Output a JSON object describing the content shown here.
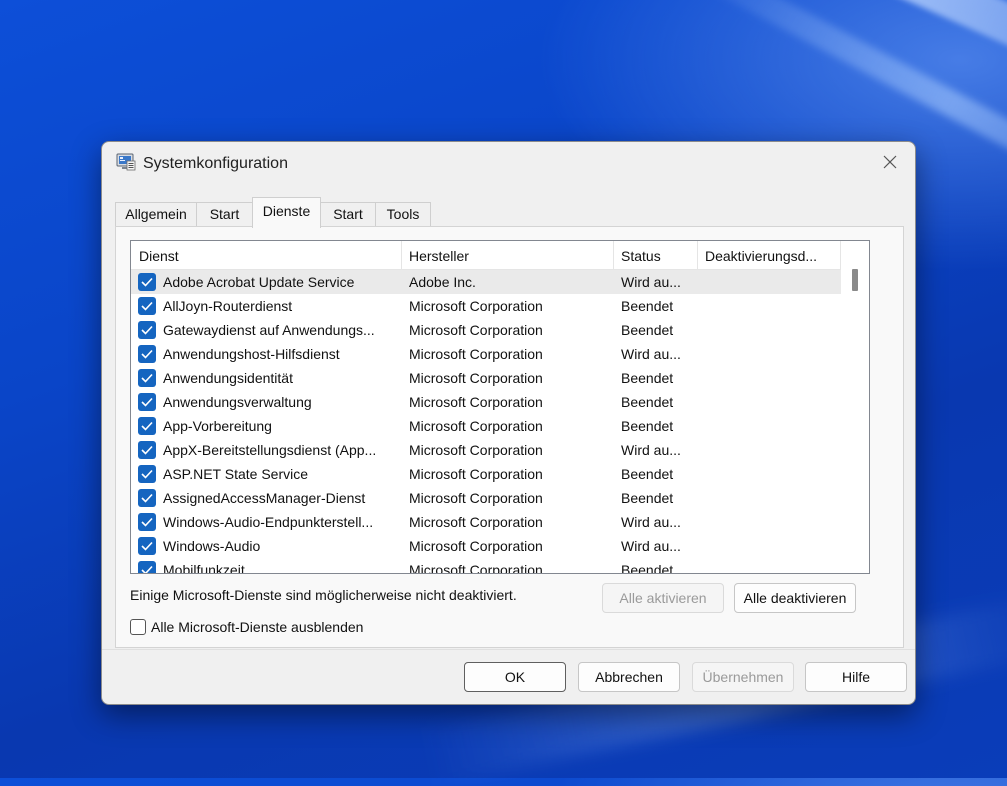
{
  "window": {
    "title": "Systemkonfiguration",
    "close_glyph": "×"
  },
  "tabs": [
    {
      "label": "Allgemein"
    },
    {
      "label": "Start"
    },
    {
      "label": "Dienste",
      "active": true
    },
    {
      "label": "Start"
    },
    {
      "label": "Tools"
    }
  ],
  "table": {
    "columns": [
      "Dienst",
      "Hersteller",
      "Status",
      "Deaktivierungsd..."
    ],
    "rows": [
      {
        "name": "Adobe Acrobat Update Service",
        "vendor": "Adobe Inc.",
        "status": "Wird au...",
        "checked": true
      },
      {
        "name": "AllJoyn-Routerdienst",
        "vendor": "Microsoft Corporation",
        "status": "Beendet",
        "checked": true
      },
      {
        "name": "Gatewaydienst auf Anwendungs...",
        "vendor": "Microsoft Corporation",
        "status": "Beendet",
        "checked": true
      },
      {
        "name": "Anwendungshost-Hilfsdienst",
        "vendor": "Microsoft Corporation",
        "status": "Wird au...",
        "checked": true
      },
      {
        "name": "Anwendungsidentität",
        "vendor": "Microsoft Corporation",
        "status": "Beendet",
        "checked": true
      },
      {
        "name": "Anwendungsverwaltung",
        "vendor": "Microsoft Corporation",
        "status": "Beendet",
        "checked": true
      },
      {
        "name": "App-Vorbereitung",
        "vendor": "Microsoft Corporation",
        "status": "Beendet",
        "checked": true
      },
      {
        "name": "AppX-Bereitstellungsdienst (App...",
        "vendor": "Microsoft Corporation",
        "status": "Wird au...",
        "checked": true
      },
      {
        "name": "ASP.NET State Service",
        "vendor": "Microsoft Corporation",
        "status": "Beendet",
        "checked": true
      },
      {
        "name": "AssignedAccessManager-Dienst",
        "vendor": "Microsoft Corporation",
        "status": "Beendet",
        "checked": true
      },
      {
        "name": "Windows-Audio-Endpunkterstell...",
        "vendor": "Microsoft Corporation",
        "status": "Wird au...",
        "checked": true
      },
      {
        "name": "Windows-Audio",
        "vendor": "Microsoft Corporation",
        "status": "Wird au...",
        "checked": true
      },
      {
        "name": "Mobilfunkzeit",
        "vendor": "Microsoft Corporation",
        "status": "Beendet",
        "checked": true
      }
    ]
  },
  "info_text": "Einige Microsoft-Dienste sind möglicherweise nicht deaktiviert.",
  "buttons": {
    "enable_all": "Alle aktivieren",
    "disable_all": "Alle deaktivieren",
    "ok": "OK",
    "cancel": "Abbrechen",
    "apply": "Übernehmen",
    "help": "Hilfe"
  },
  "hide_ms_checkbox": {
    "label": "Alle Microsoft-Dienste ausblenden",
    "checked": false
  },
  "colors": {
    "accent": "#1565c0",
    "desktop": "#0a45c8"
  }
}
